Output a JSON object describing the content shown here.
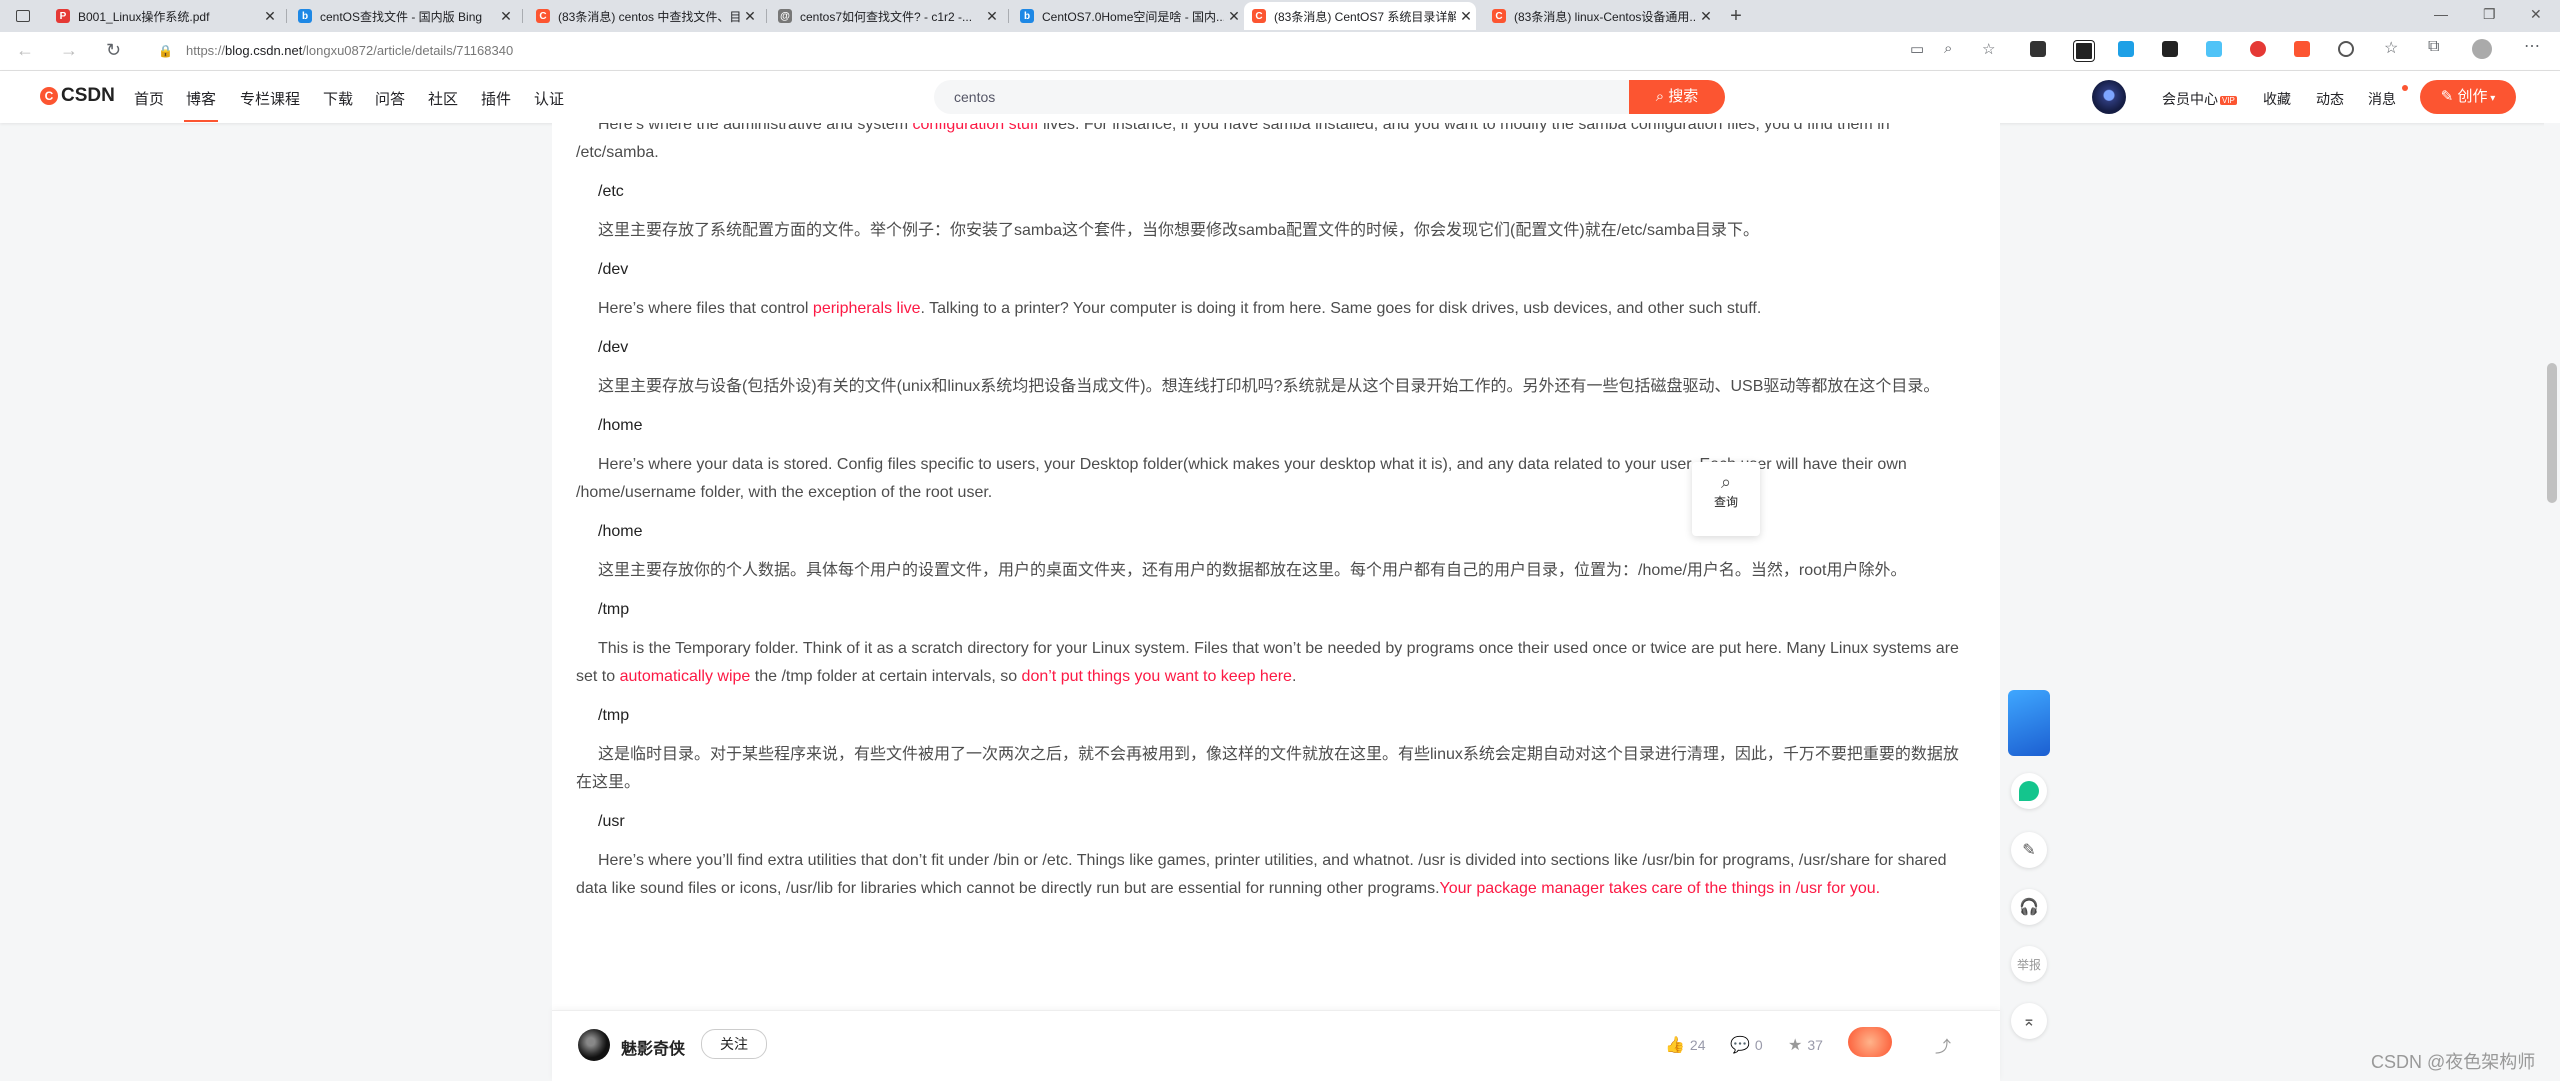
{
  "browser": {
    "tabs": [
      {
        "title": "B001_Linux操作系统.pdf",
        "favicon_color": "#e53935",
        "favicon_char": "P"
      },
      {
        "title": "centOS查找文件 - 国内版 Bing",
        "favicon_color": "#1e88e5",
        "favicon_char": "b"
      },
      {
        "title": "(83条消息) centos 中查找文件、目录...",
        "favicon_color": "#fc5531",
        "favicon_char": "C"
      },
      {
        "title": "centos7如何查找文件? - c1r2 -...",
        "favicon_color": "#666666",
        "favicon_char": "@"
      },
      {
        "title": "CentOS7.0Home空间是啥 - 国内...",
        "favicon_color": "#1e88e5",
        "favicon_char": "b"
      },
      {
        "title": "(83条消息) CentOS7 系统目录详解...",
        "favicon_color": "#fc5531",
        "favicon_char": "C"
      },
      {
        "title": "(83条消息) linux-Centos设备通用...",
        "favicon_color": "#fc5531",
        "favicon_char": "C"
      }
    ],
    "new_tab": "+",
    "url_prefix": "https://",
    "url_host": "blog.csdn.net",
    "url_path": "/longxu0872/article/details/71168340"
  },
  "site": {
    "logo_text": "CSDN",
    "nav": [
      "首页",
      "博客",
      "专栏课程",
      "下载",
      "问答",
      "社区",
      "插件",
      "认证"
    ],
    "search_value": "centos",
    "search_button": "搜索",
    "right_links": {
      "vip": "会员中心",
      "vip_badge": "VIP",
      "favorites": "收藏",
      "dynamic": "动态",
      "messages": "消息"
    },
    "create_button": "创作"
  },
  "article": {
    "p0": {
      "a": "Here’s where the administrative and system ",
      "red": "configuration stuff",
      "b": " lives. For instance, if you have samba installed, and you want to modify the samba configuration files, you’d find them in /etc/samba."
    },
    "h1": "/etc",
    "p1": "这里主要存放了系统配置方面的文件。举个例子：你安装了samba这个套件，当你想要修改samba配置文件的时候，你会发现它们(配置文件)就在/etc/samba目录下。",
    "h2": "/dev",
    "p2": {
      "a": "Here’s where files that control ",
      "red": "peripherals live",
      "b": ". Talking to a printer? Your computer is doing it from here. Same goes for disk drives, usb devices, and other such stuff."
    },
    "h3": "/dev",
    "p3": "这里主要存放与设备(包括外设)有关的文件(unix和linux系统均把设备当成文件)。想连线打印机吗?系统就是从这个目录开始工作的。另外还有一些包括磁盘驱动、USB驱动等都放在这个目录。",
    "h4": "/home",
    "p4": "Here’s where your data is stored. Config files specific to users, your Desktop folder(whick makes your desktop what it is), and any data related to your user. Each user will have their own /home/username folder, with the exception of the root user.",
    "h5": "/home",
    "p5": "这里主要存放你的个人数据。具体每个用户的设置文件，用户的桌面文件夹，还有用户的数据都放在这里。每个用户都有自己的用户目录，位置为：/home/用户名。当然，root用户除外。",
    "h6": "/tmp",
    "p6": {
      "a": "This is the Temporary folder. Think of it as a scratch directory for your Linux system. Files that won’t be needed by programs once their used once or twice are put here. Many Linux systems are set to ",
      "red1": "automatically wipe",
      "b": " the /tmp folder at certain intervals, so ",
      "red2": "don’t put things you want to keep here",
      "c": "."
    },
    "h7": "/tmp",
    "p7": "这是临时目录。对于某些程序来说，有些文件被用了一次两次之后，就不会再被用到，像这样的文件就放在这里。有些linux系统会定期自动对这个目录进行清理，因此，千万不要把重要的数据放在这里。",
    "h8": "/usr",
    "p8": {
      "a": "Here’s where you’ll find extra utilities that don’t fit under /bin or /etc. Things like games, printer utilities, and whatnot. /usr is divided into sections like /usr/bin for programs, /usr/share for shared data like sound files or icons, /usr/lib for libraries which cannot be directly run but are essential for running other programs.",
      "red": "Your package manager takes care of the things in /usr for you."
    }
  },
  "lookup_popup": "查询",
  "bottom": {
    "author": "魅影奇侠",
    "follow": "关注",
    "likes": "24",
    "comments": "0",
    "stars": "37"
  },
  "side": {
    "report": "举报"
  },
  "watermark": "CSDN @夜色架构师"
}
